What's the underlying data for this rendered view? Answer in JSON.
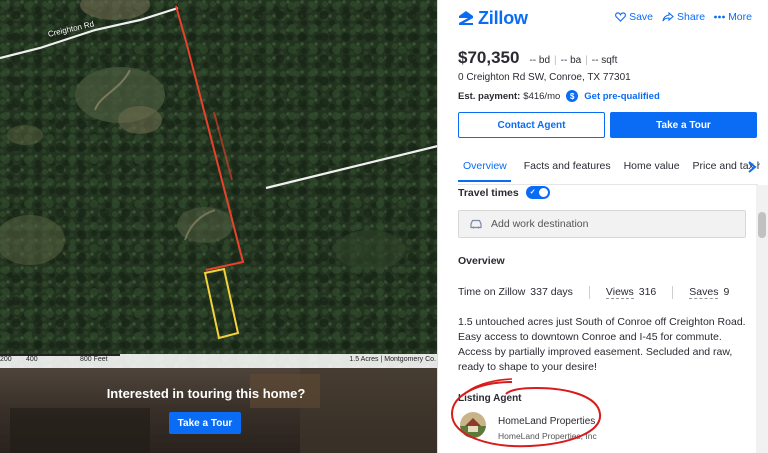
{
  "map": {
    "road_label": "Creighton Rd",
    "scale_ticks": [
      "200",
      "400",
      "800 Feet"
    ],
    "attribution": "1.5 Acres | Montgomery Co."
  },
  "tour_banner": {
    "title": "Interested in touring this home?",
    "button": "Take a Tour"
  },
  "header": {
    "logo_text": "Zillow",
    "save": "Save",
    "share": "Share",
    "more": "More"
  },
  "listing": {
    "price": "$70,350",
    "beds": "-- bd",
    "baths": "-- ba",
    "sqft": "-- sqft",
    "address": "0 Creighton Rd SW, Conroe, TX 77301",
    "est_payment_label": "Est. payment:",
    "est_payment_value": "$416/mo",
    "prequal": "Get pre-qualified"
  },
  "buttons": {
    "contact": "Contact Agent",
    "tour": "Take a Tour"
  },
  "tabs": [
    "Overview",
    "Facts and features",
    "Home value",
    "Price and tax history"
  ],
  "travel": {
    "label": "Travel times",
    "placeholder": "Add work destination"
  },
  "overview": {
    "title": "Overview",
    "time_label": "Time on Zillow",
    "time_value": "337 days",
    "views_label": "Views",
    "views_value": "316",
    "saves_label": "Saves",
    "saves_value": "9",
    "description": "1.5 untouched acres just South of Conroe off Creighton Road. Easy access to downtown Conroe and I-45 for commute. Access by partially improved easement. Secluded and raw, ready to shape to your desire!"
  },
  "agent": {
    "section_title": "Listing Agent",
    "name": "HomeLand Properties",
    "company": "HomeLand Properties, Inc"
  },
  "colors": {
    "brand": "#0a6cf5",
    "parcel_outline": "#e8412c",
    "highlight_box": "#f2d23a",
    "annotation": "#d81b1b"
  }
}
